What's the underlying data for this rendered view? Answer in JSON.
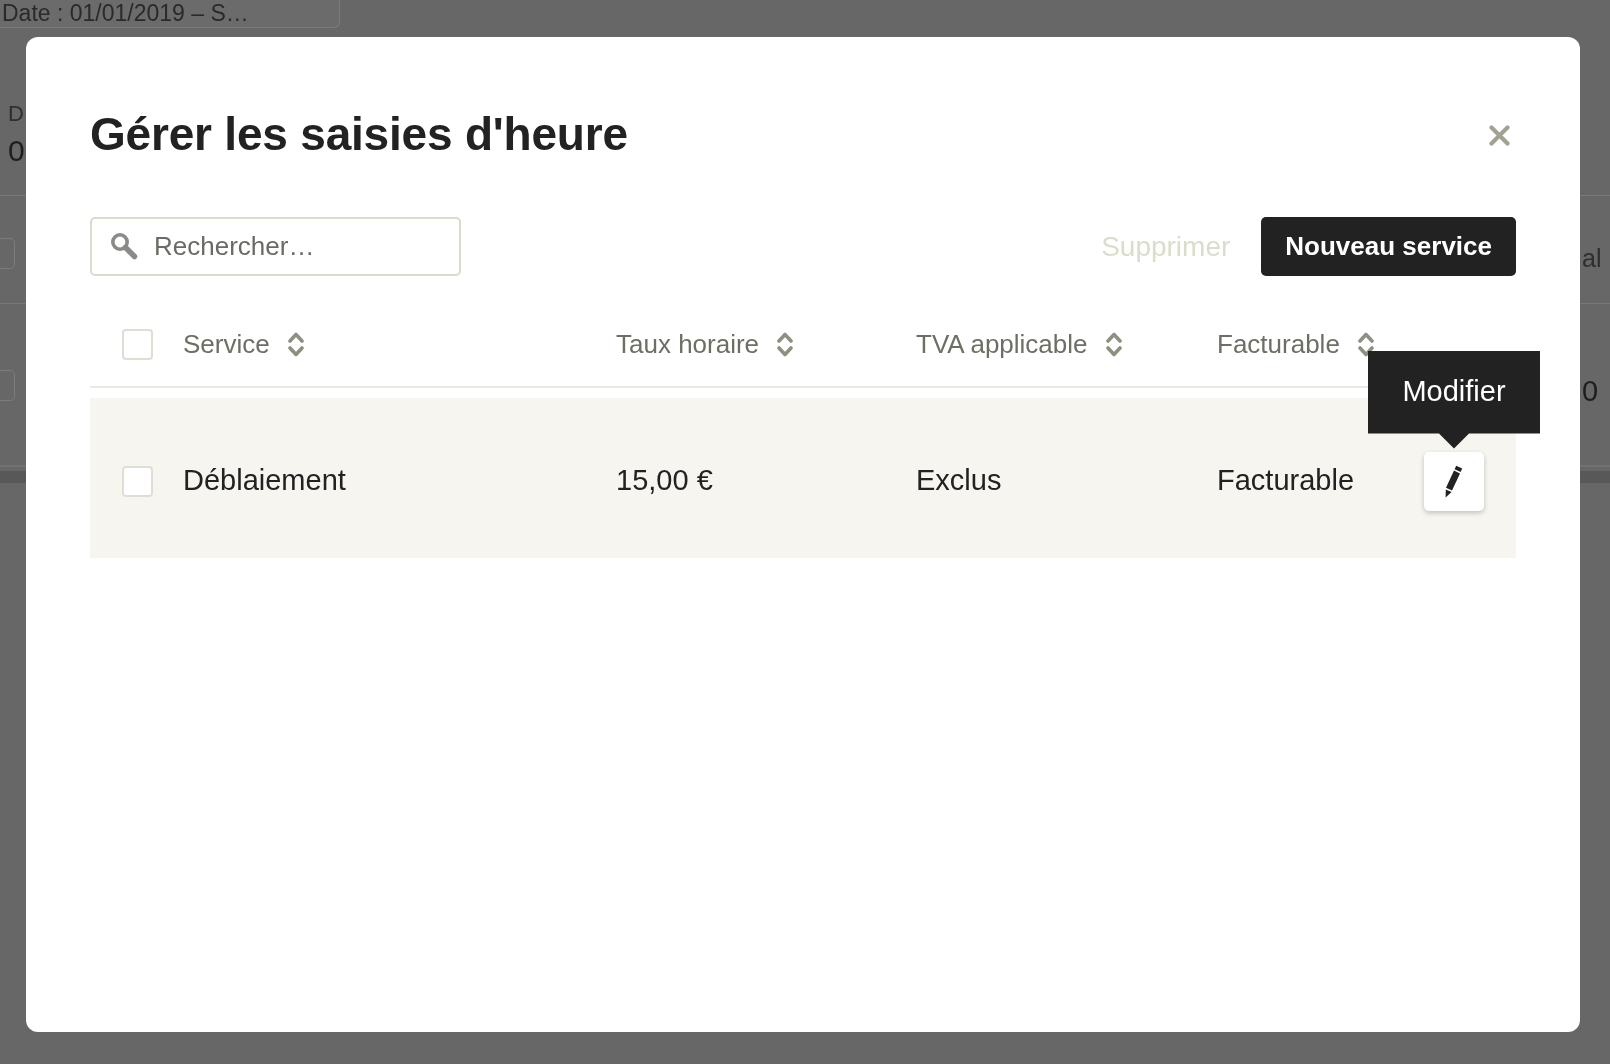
{
  "backdrop": {
    "header_text": "Date : 01/01/2019 – S…",
    "summary": {
      "label": "D",
      "value": "0"
    },
    "table_header": {
      "checked": false,
      "text": "al"
    },
    "table_row": {
      "checked": false,
      "text": "0"
    }
  },
  "dialog": {
    "title": "Gérer les saisies d'heure"
  },
  "search": {
    "placeholder": "Rechercher…"
  },
  "actions": [
    {
      "kind": "link",
      "label": "Supprimer",
      "disabled": true
    },
    {
      "kind": "primary",
      "label": "Nouveau service",
      "disabled": false
    }
  ],
  "table": {
    "select_all_checked": false,
    "columns": [
      {
        "label": "Service",
        "sortable": true
      },
      {
        "label": "Taux horaire",
        "sortable": true
      },
      {
        "label": "TVA applicable",
        "sortable": true
      },
      {
        "label": "Facturable",
        "sortable": true
      }
    ],
    "rows": [
      {
        "checked": false,
        "highlighted": true,
        "cells": [
          "Déblaiement",
          "15,00 €",
          "Exclus",
          "Facturable"
        ],
        "edit_tooltip": "Modifier"
      }
    ]
  }
}
